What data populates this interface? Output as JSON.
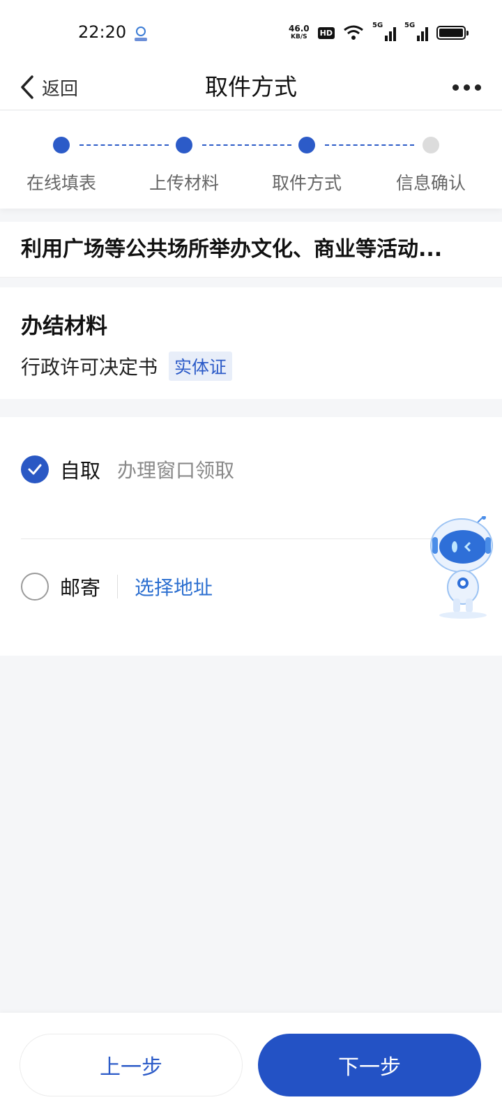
{
  "status_bar": {
    "time": "22:20",
    "net_speed_value": "46.0",
    "net_speed_unit": "KB/S",
    "hd_label": "HD",
    "signal_label_1": "5G",
    "signal_label_2": "5G",
    "icons": [
      "app-notification-icon",
      "hd-icon",
      "wifi-icon",
      "signal-icon",
      "signal-icon",
      "battery-icon"
    ]
  },
  "nav": {
    "back_label": "返回",
    "title": "取件方式",
    "more_icon": "more-icon"
  },
  "stepper": {
    "steps": [
      {
        "label": "在线填表",
        "state": "done"
      },
      {
        "label": "上传材料",
        "state": "done"
      },
      {
        "label": "取件方式",
        "state": "current"
      },
      {
        "label": "信息确认",
        "state": "pending"
      }
    ],
    "active_color": "#2c5bc8",
    "pending_color": "#dcdcdc"
  },
  "service": {
    "title": "利用广场等公共场所举办文化、商业等活动..."
  },
  "materials": {
    "heading": "办结材料",
    "item_name": "行政许可决定书",
    "item_tag": "实体证"
  },
  "pickup": {
    "options": [
      {
        "label": "自取",
        "desc": "办理窗口领取",
        "checked": true
      },
      {
        "label": "邮寄",
        "link": "选择地址",
        "checked": false
      }
    ]
  },
  "footer": {
    "prev_label": "上一步",
    "next_label": "下一步"
  },
  "colors": {
    "primary": "#2352c5",
    "link": "#2c6fd0",
    "background": "#f5f6f8"
  }
}
